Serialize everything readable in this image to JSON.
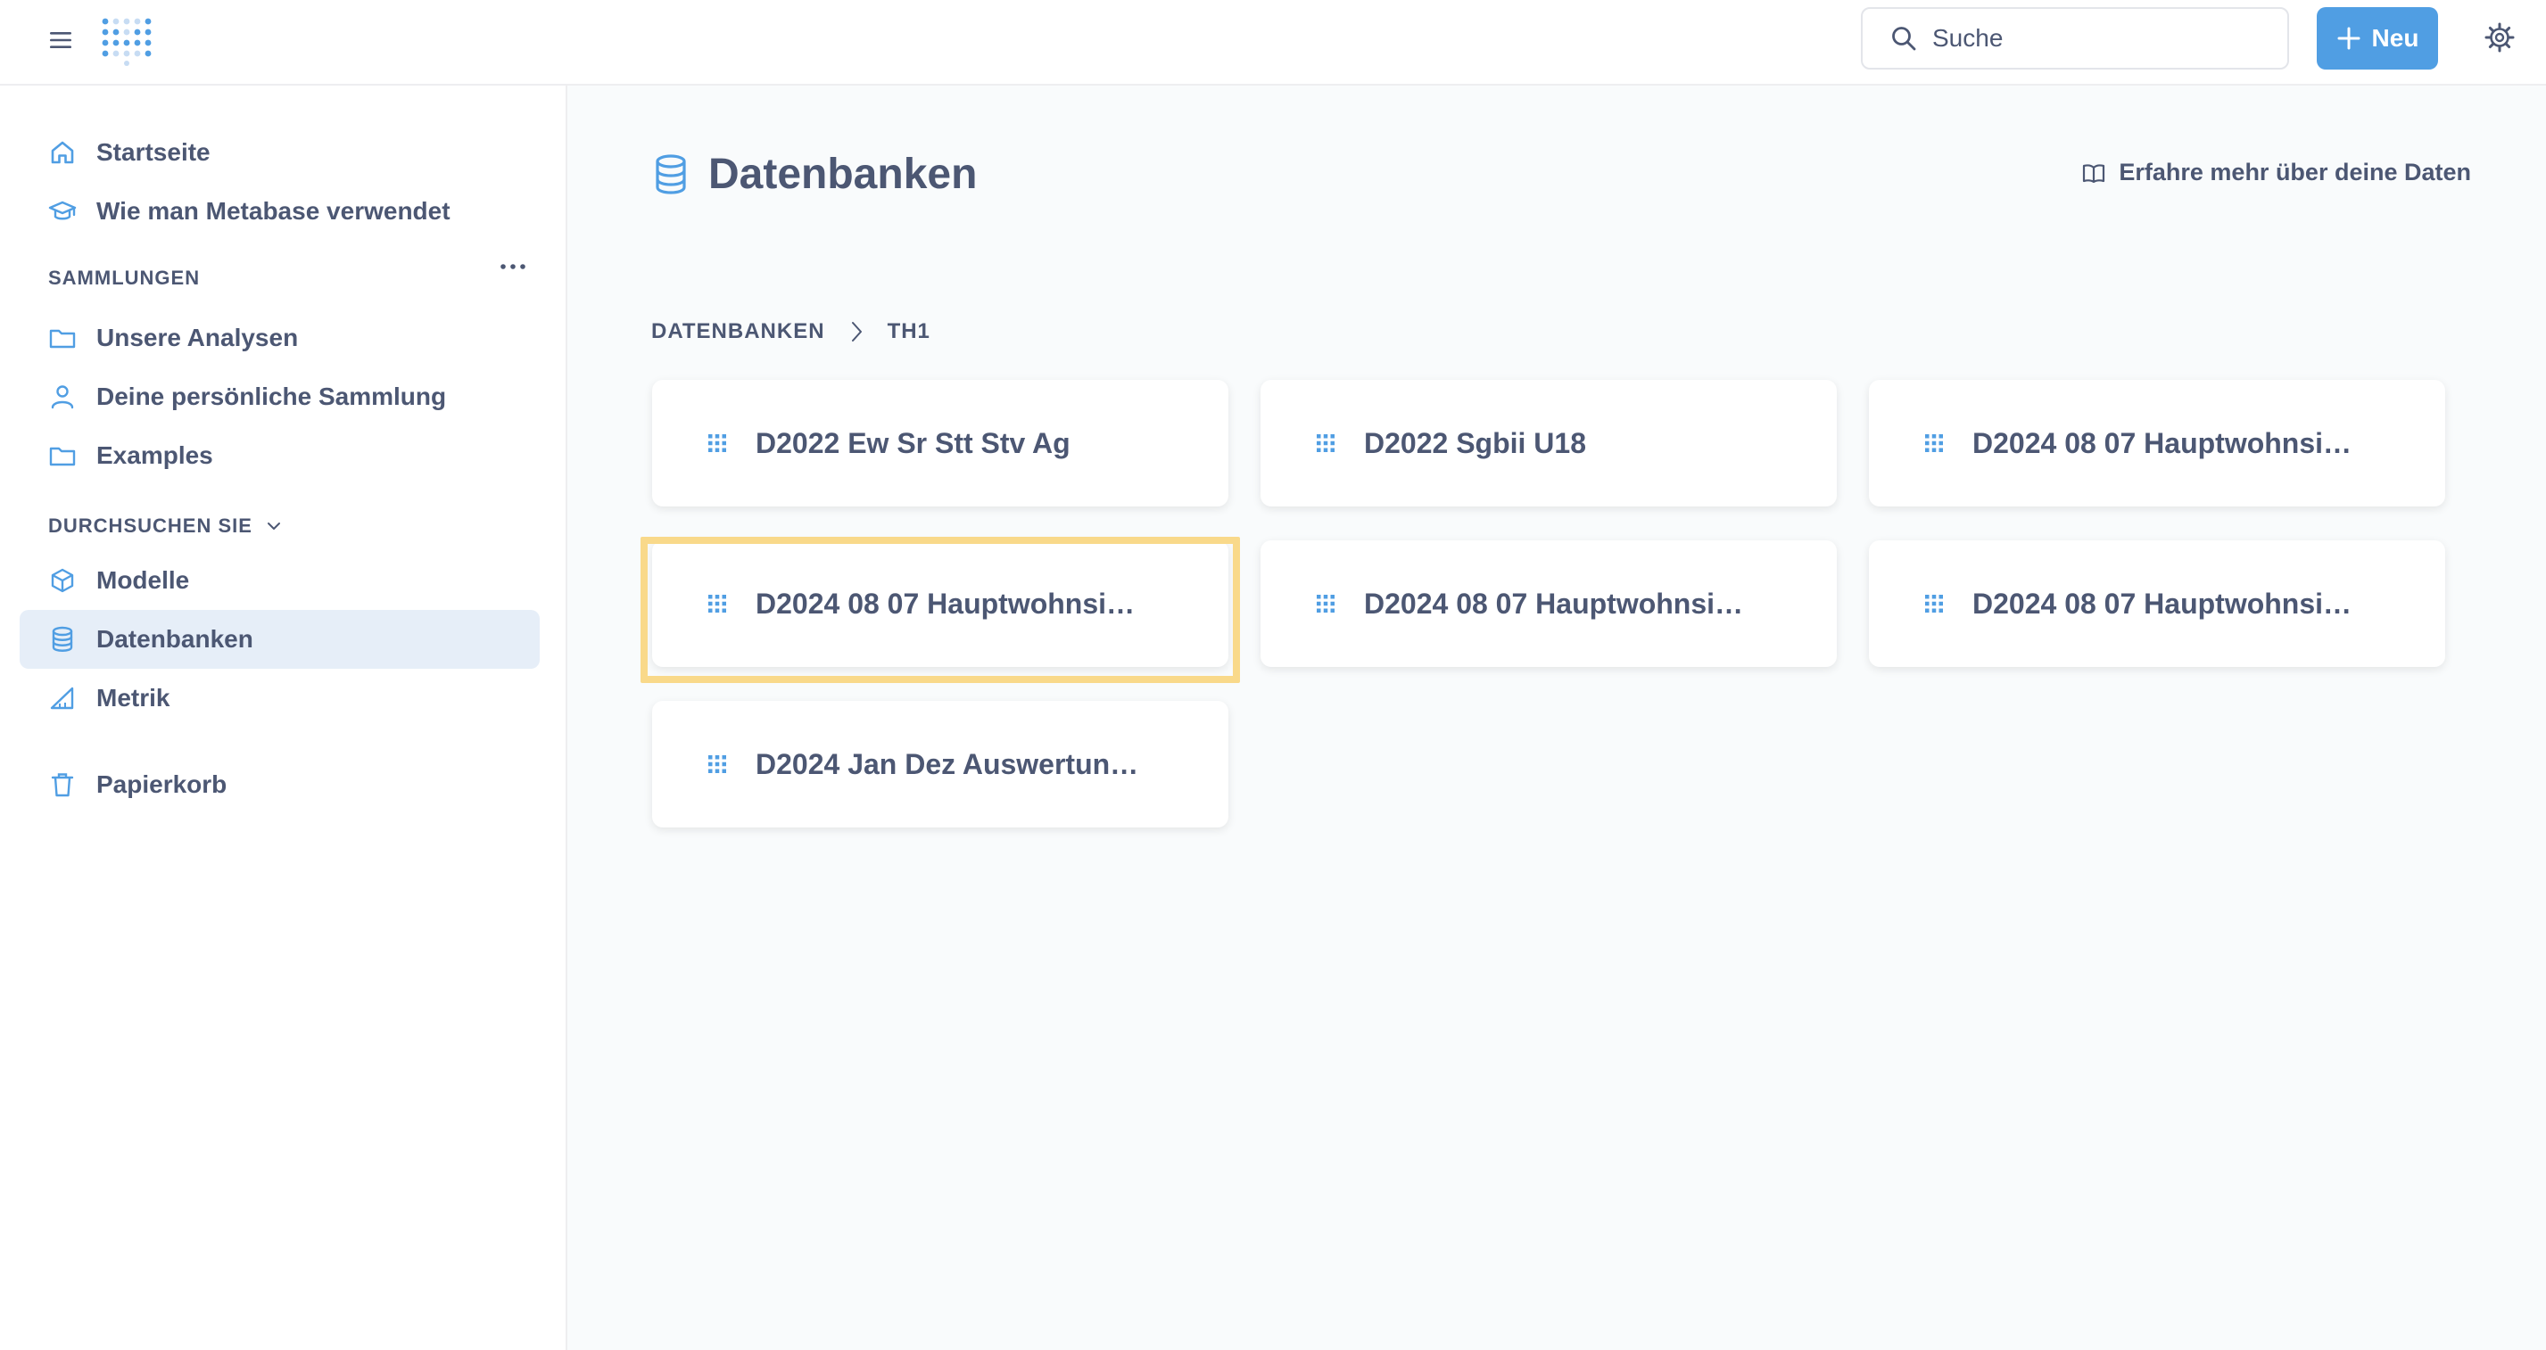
{
  "search": {
    "label": "Suche"
  },
  "new_button": {
    "label": "Neu"
  },
  "sidebar": {
    "top_items": [
      {
        "label": "Startseite",
        "icon": "home-icon"
      },
      {
        "label": "Wie man Metabase verwendet",
        "icon": "graduation-cap-icon"
      }
    ],
    "collections_label": "SAMMLUNGEN",
    "collections": [
      {
        "label": "Unsere Analysen",
        "icon": "folder-icon"
      },
      {
        "label": "Deine persönliche Sammlung",
        "icon": "person-icon"
      },
      {
        "label": "Examples",
        "icon": "folder-icon"
      }
    ],
    "browse_label": "DURCHSUCHEN SIE",
    "browse": [
      {
        "label": "Modelle",
        "icon": "cube-icon"
      },
      {
        "label": "Datenbanken",
        "icon": "database-icon",
        "active": true
      },
      {
        "label": "Metrik",
        "icon": "metric-icon"
      }
    ],
    "trash": {
      "label": "Papierkorb",
      "icon": "trash-icon"
    }
  },
  "main": {
    "title": "Datenbanken",
    "learn_link": "Erfahre mehr über deine Daten",
    "breadcrumb": [
      "DATENBANKEN",
      "TH1"
    ],
    "tables": [
      "D2022 Ew Sr Stt Stv Ag",
      "D2022 Sgbii U18",
      "D2024 08 07 Hauptwohnsi…",
      "D2024 08 07 Hauptwohnsi…",
      "D2024 08 07 Hauptwohnsi…",
      "D2024 08 07 Hauptwohnsi…",
      "D2024 Jan Dez Auswertun…"
    ]
  },
  "colors": {
    "brand": "#509ee3",
    "text": "#4c5773",
    "active_bg": "#e6eef8",
    "highlight": "#f9d98a"
  }
}
